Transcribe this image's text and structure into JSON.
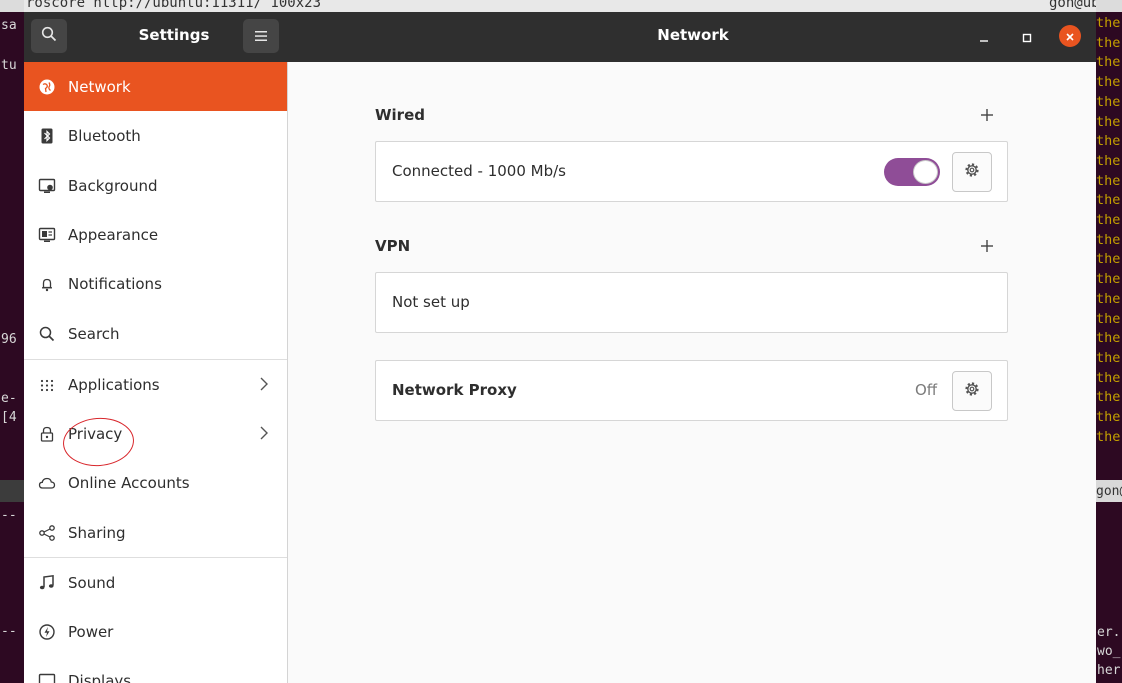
{
  "background_terminal": {
    "title_left": "roscore http://ubuntu:11311/ 100x23",
    "title_right": "gon@ubu",
    "right_title_trunc": "gon@",
    "left_fragments": [
      "sa",
      "tu",
      "96",
      "e-",
      "[4",
      "--",
      "--"
    ],
    "right_lines": [
      "the",
      "the",
      "the",
      "the",
      "the",
      "the",
      "the",
      "the",
      "the",
      "the",
      "the",
      "the",
      "the",
      "the",
      "the",
      "the",
      "the",
      "the",
      "the",
      "the",
      "the",
      "the"
    ],
    "right_tail": [
      "er.",
      "wo_",
      "her"
    ]
  },
  "window": {
    "sidebar_title": "Settings",
    "panel_title": "Network",
    "accent_color": "#e95420",
    "search_icon": "search-icon",
    "menu_icon": "hamburger-menu-icon"
  },
  "sidebar": {
    "items": [
      {
        "label": "Network",
        "icon": "network-icon",
        "active": true
      },
      {
        "label": "Bluetooth",
        "icon": "bluetooth-icon"
      },
      {
        "label": "Background",
        "icon": "background-icon"
      },
      {
        "label": "Appearance",
        "icon": "appearance-icon"
      },
      {
        "label": "Notifications",
        "icon": "bell-icon"
      },
      {
        "label": "Search",
        "icon": "search-icon"
      },
      {
        "label": "Applications",
        "icon": "grid-icon",
        "chevron": true
      },
      {
        "label": "Privacy",
        "icon": "lock-icon",
        "chevron": true
      },
      {
        "label": "Online Accounts",
        "icon": "cloud-icon"
      },
      {
        "label": "Sharing",
        "icon": "share-icon"
      },
      {
        "label": "Sound",
        "icon": "music-note-icon"
      },
      {
        "label": "Power",
        "icon": "power-icon"
      },
      {
        "label": "Displays",
        "icon": "display-icon"
      }
    ]
  },
  "network": {
    "wired": {
      "title": "Wired",
      "status": "Connected - 1000 Mb/s",
      "toggle_on": true,
      "toggle_color": "#8f4d97"
    },
    "vpn": {
      "title": "VPN",
      "status": "Not set up"
    },
    "proxy": {
      "title": "Network Proxy",
      "state": "Off"
    }
  }
}
